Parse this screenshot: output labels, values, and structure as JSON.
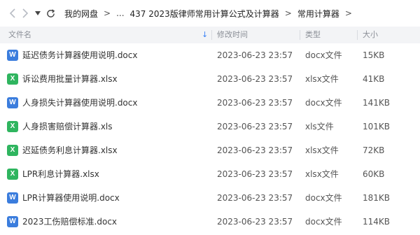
{
  "nav": {
    "back_icon": "chevron-left-icon",
    "forward_icon": "chevron-right-icon",
    "dropdown_icon": "caret-down-icon",
    "refresh_icon": "refresh-icon",
    "breadcrumb": [
      "我的网盘",
      "...",
      "437  2023版律师常用计算公式及计算器",
      "常用计算器"
    ],
    "separator": ">"
  },
  "table": {
    "headers": {
      "name": "文件名",
      "sort_icon": "↓",
      "mtime": "修改时间",
      "type": "类型",
      "size": "大小"
    },
    "rows": [
      {
        "icon": "word-icon",
        "icon_label": "W",
        "icon_color": "#3b7ddd",
        "name": "延迟债务计算器使用说明.docx",
        "mtime": "2023-06-23 23:57",
        "type": "docx文件",
        "size": "15KB"
      },
      {
        "icon": "excel-icon",
        "icon_label": "X",
        "icon_color": "#2fb55f",
        "name": "诉讼费用批量计算器.xlsx",
        "mtime": "2023-06-23 23:57",
        "type": "xlsx文件",
        "size": "41KB"
      },
      {
        "icon": "word-icon",
        "icon_label": "W",
        "icon_color": "#3b7ddd",
        "name": "人身损失计算器使用说明.docx",
        "mtime": "2023-06-23 23:57",
        "type": "docx文件",
        "size": "141KB"
      },
      {
        "icon": "excel-icon",
        "icon_label": "X",
        "icon_color": "#2fb55f",
        "name": "人身损害赔偿计算器.xls",
        "mtime": "2023-06-23 23:57",
        "type": "xls文件",
        "size": "101KB"
      },
      {
        "icon": "excel-icon",
        "icon_label": "X",
        "icon_color": "#2fb55f",
        "name": "迟延债务利息计算器.xlsx",
        "mtime": "2023-06-23 23:57",
        "type": "xlsx文件",
        "size": "72KB"
      },
      {
        "icon": "excel-icon",
        "icon_label": "X",
        "icon_color": "#2fb55f",
        "name": "LPR利息计算器.xlsx",
        "mtime": "2023-06-23 23:57",
        "type": "xlsx文件",
        "size": "60KB"
      },
      {
        "icon": "word-icon",
        "icon_label": "W",
        "icon_color": "#3b7ddd",
        "name": "LPR计算器使用说明.docx",
        "mtime": "2023-06-23 23:57",
        "type": "docx文件",
        "size": "181KB"
      },
      {
        "icon": "word-icon",
        "icon_label": "W",
        "icon_color": "#3b7ddd",
        "name": "2023工伤赔偿标准.docx",
        "mtime": "2023-06-23 23:57",
        "type": "docx文件",
        "size": "114KB"
      }
    ]
  }
}
